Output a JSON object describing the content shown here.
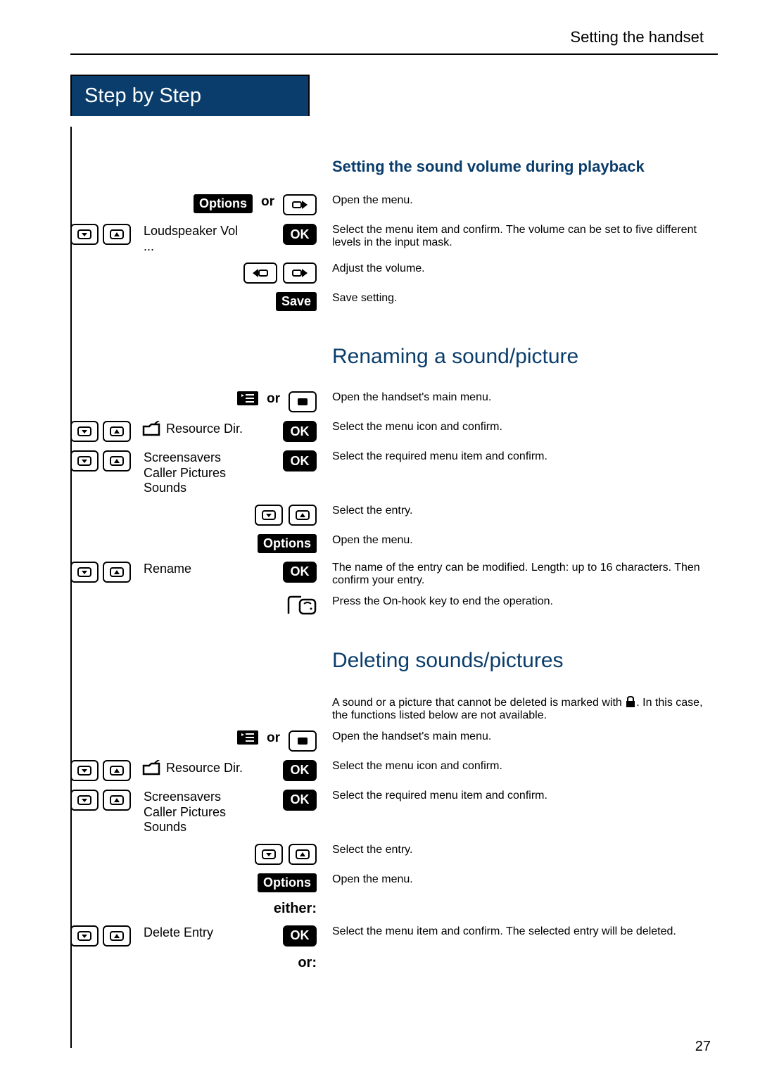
{
  "header": {
    "section": "Setting the handset"
  },
  "step_header": "Step by Step",
  "sec1": {
    "title": "Setting the sound volume during playback",
    "options_label": "Options",
    "or": "or",
    "open_menu": "Open the menu.",
    "loudspeaker": "Loudspeaker Vol",
    "ellipsis": "...",
    "ok": "OK",
    "select_confirm": "Select the menu item and confirm. The volume can be set to five different levels in the input mask.",
    "adjust": "Adjust the volume.",
    "save_label": "Save",
    "save_setting": "Save setting."
  },
  "sec2": {
    "title": "Renaming a sound/picture",
    "or": "or",
    "open_main": "Open the handset's main menu.",
    "resource_dir": "Resource Dir.",
    "ok": "OK",
    "select_icon": "Select the menu icon and confirm.",
    "items": "Screensavers\nCaller Pictures\nSounds",
    "select_required": "Select the required menu item and confirm.",
    "select_entry": "Select the entry.",
    "options_label": "Options",
    "open_menu": "Open the menu.",
    "rename": "Rename",
    "rename_desc": "The name of the entry can be modified. Length: up to 16 characters. Then confirm your entry.",
    "onhook": "Press the On-hook key to end the operation."
  },
  "sec3": {
    "title": "Deleting sounds/pictures",
    "intro1": "A sound or a picture that cannot be deleted is marked with ",
    "intro2": ". In this case, the functions listed below are not available.",
    "or": "or",
    "open_main": "Open the handset's main menu.",
    "resource_dir": "Resource Dir.",
    "ok": "OK",
    "select_icon": "Select the menu icon and confirm.",
    "items": "Screensavers\nCaller Pictures\nSounds",
    "select_required": "Select the required menu item and confirm.",
    "select_entry": "Select the entry.",
    "options_label": "Options",
    "open_menu": "Open the menu.",
    "either": "either:",
    "delete_entry": "Delete Entry",
    "delete_desc": "Select the menu item and confirm. The selected entry will be deleted.",
    "or_final": "or:"
  },
  "page_number": "27"
}
